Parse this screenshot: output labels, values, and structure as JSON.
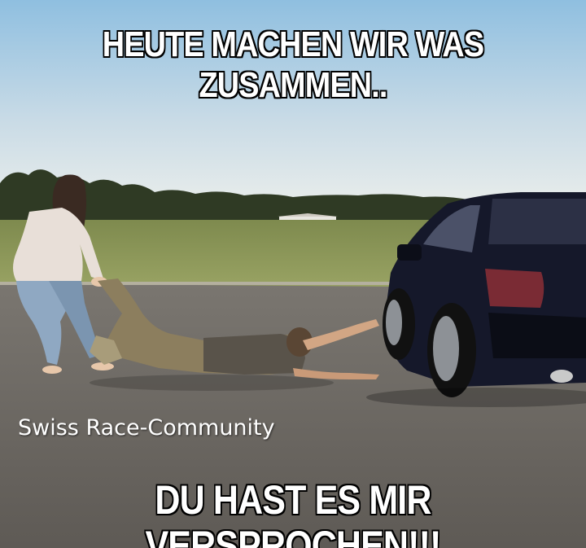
{
  "meme": {
    "top_text": "HEUTE MACHEN WIR WAS ZUSAMMEN..",
    "bottom_text": "DU HAST ES MIR VERSPROCHEN!!!",
    "watermark": "Swiss Race-Community"
  },
  "colors": {
    "sky_top": "#9cc6e2",
    "sky_horizon": "#e6ecec",
    "grass": "#8e9a5c",
    "asphalt": "#6b6762",
    "car_body": "#13162a",
    "caption_text": "#ffffff",
    "caption_outline": "#000000"
  }
}
